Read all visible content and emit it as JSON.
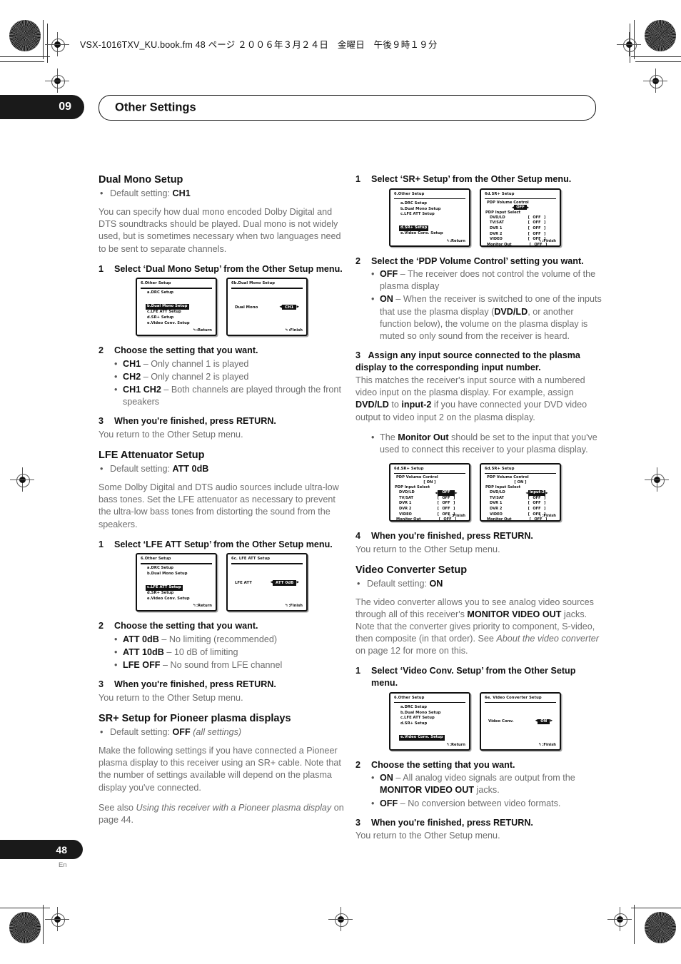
{
  "runhead": "VSX-1016TXV_KU.book.fm 48 ページ ２００６年３月２４日　金曜日　午後９時１９分",
  "banner": {
    "number": "09",
    "title": "Other Settings"
  },
  "footer": {
    "page": "48",
    "lang": "En"
  },
  "left": {
    "dual_mono": {
      "heading": "Dual Mono Setup",
      "default_prefix": "Default setting: ",
      "default_value": "CH1",
      "intro": "You can specify how dual mono encoded Dolby Digital and DTS soundtracks should be played. Dual mono is not widely used, but is sometimes necessary when two languages need to be sent to separate channels.",
      "step1_n": "1",
      "step1": "Select ‘Dual Mono Setup’ from the Other Setup menu.",
      "step2_n": "2",
      "step2": "Choose the setting that you want.",
      "options": [
        {
          "term": "CH1",
          "desc": " – Only channel 1 is played"
        },
        {
          "term": "CH2",
          "desc": " – Only channel 2 is played"
        },
        {
          "term": "CH1 CH2",
          "desc": " – Both channels are played through the front speakers"
        }
      ],
      "step3_n": "3",
      "step3": "When you're finished, press RETURN.",
      "step3_note": "You return to the Other Setup menu."
    },
    "lfe": {
      "heading": "LFE Attenuator Setup",
      "default_prefix": "Default setting: ",
      "default_value": "ATT 0dB",
      "intro": "Some Dolby Digital and DTS audio sources include ultra-low bass tones. Set the LFE attenuator as necessary to prevent the ultra-low bass tones from distorting the sound from the speakers.",
      "step1_n": "1",
      "step1": "Select ‘LFE ATT Setup’ from the Other Setup menu.",
      "step2_n": "2",
      "step2": "Choose the setting that you want.",
      "options": [
        {
          "term": "ATT 0dB",
          "desc": " – No limiting (recommended)"
        },
        {
          "term": "ATT 10dB",
          "desc": " – 10 dB of limiting"
        },
        {
          "term": "LFE OFF",
          "desc": " – No sound from LFE channel"
        }
      ],
      "step3_n": "3",
      "step3": "When you're finished, press RETURN.",
      "step3_note": "You return to the Other Setup menu."
    },
    "srplus": {
      "heading": "SR+ Setup for Pioneer plasma displays",
      "default_prefix": "Default setting: ",
      "default_value": "OFF",
      "default_suffix": " (all settings)",
      "para1": "Make the following settings if you have connected a Pioneer plasma display to this receiver using an SR+ cable. Note that the number of settings available will depend on the plasma display you've connected.",
      "para2_pre": "See also ",
      "para2_em": "Using this receiver with a Pioneer plasma display",
      "para2_post": " on page 44."
    }
  },
  "right": {
    "srplus_steps": {
      "step1_n": "1",
      "step1": "Select ‘SR+ Setup’ from the Other Setup menu.",
      "step2_n": "2",
      "step2": "Select the ‘PDP Volume Control’ setting you want.",
      "options": [
        {
          "term": "OFF",
          "desc": " – The receiver does not control the volume of the plasma display"
        },
        {
          "term": "ON",
          "desc": " – When the receiver is switched to one of the inputs that use the plasma display (",
          "bold2": "DVD/LD",
          "desc2": ", or another function below), the volume on the plasma display is muted so only sound from the receiver is heard."
        }
      ],
      "step3_n": "3",
      "step3": "Assign any input source connected to the plasma display to the corresponding input number.",
      "step3_para_a": "This matches the receiver's input source with a numbered video input on the plasma display. For example, assign ",
      "step3_b1": "DVD/LD",
      "step3_para_b": " to ",
      "step3_b2": "input-2",
      "step3_para_c": " if you have connected your DVD video output to video input 2 on the plasma display.",
      "note_pre": "The ",
      "note_b": "Monitor Out",
      "note_post": " should be set to the input that you've used to connect this receiver to your plasma display.",
      "step4_n": "4",
      "step4": "When you're finished, press RETURN.",
      "step4_note": "You return to the Other Setup menu."
    },
    "video_conv": {
      "heading": "Video Converter Setup",
      "default_prefix": "Default setting: ",
      "default_value": "ON",
      "para_a": "The video converter allows you to see analog video sources through all of this receiver's ",
      "para_b": "MONITOR VIDEO OUT",
      "para_c": " jacks. Note that the converter gives priority to component, S-video, then composite (in that order). See ",
      "para_em": "About the video converter",
      "para_d": " on page 12 for more on this.",
      "step1_n": "1",
      "step1": "Select ‘Video Conv. Setup’ from the Other Setup menu.",
      "step2_n": "2",
      "step2": "Choose the setting that you want.",
      "options": [
        {
          "term": "ON",
          "desc": " – All analog video signals are output from the ",
          "bold2": "MONITOR VIDEO OUT",
          "desc2": " jacks."
        },
        {
          "term": "OFF",
          "desc": " – No conversion between video formats."
        }
      ],
      "step3_n": "3",
      "step3": "When you're finished, press RETURN.",
      "step3_note": "You return to the Other Setup menu."
    }
  },
  "osd": {
    "other_setup_title": "6.Other  Setup",
    "menu_items": [
      "a.DRC  Setup",
      "b.Dual  Mono  Setup",
      "c.LFE  ATT  Setup",
      "d.SR+  Setup",
      "e.Video Conv. Setup"
    ],
    "return_label": ":Return",
    "finish_label": ":Finish",
    "dual_mono": {
      "title": "6b.Dual  Mono  Setup",
      "label": "Dual Mono",
      "value": "CH1"
    },
    "lfe_att": {
      "title": "6c. LFE  ATT  Setup",
      "label": "LFE ATT",
      "value": "ATT 0dB"
    },
    "video_conv": {
      "title": "6e. Video Converter Setup",
      "label": "Video Conv.",
      "value": "ON"
    },
    "srplus": {
      "title": "6d.SR+  Setup",
      "vol_head": "PDP  Volume  Control",
      "input_head": "PDP  Input  Select",
      "vol_off": "OFF",
      "vol_on": "ON",
      "rows": [
        "DVD/LD",
        "TV/SAT",
        "DVR 1",
        "DVR 2",
        "VIDEO"
      ],
      "monitor_row": "Monitor Out",
      "value_off": "OFF",
      "value_input2": "input-2"
    }
  }
}
